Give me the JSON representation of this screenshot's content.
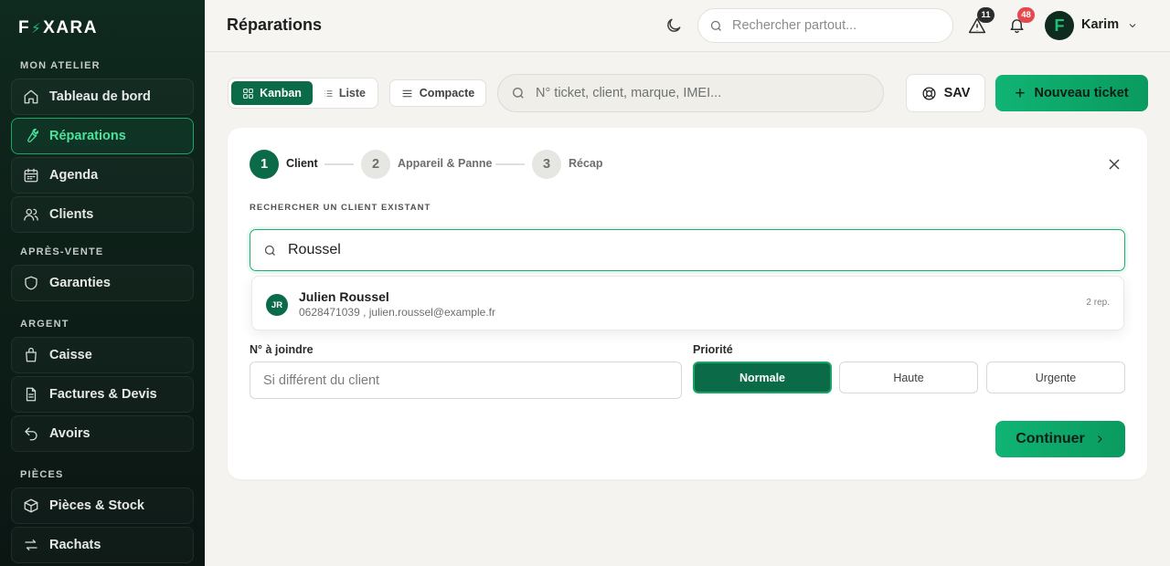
{
  "app": {
    "logo": {
      "left": "F",
      "bolt": "⚡",
      "right": "XARA"
    }
  },
  "sidebar": {
    "sections": [
      {
        "title": "MON ATELIER",
        "items": [
          {
            "label": "Tableau de bord",
            "icon": "home-icon"
          },
          {
            "label": "Réparations",
            "icon": "wrench-icon",
            "active": true
          },
          {
            "label": "Agenda",
            "icon": "calendar-icon"
          },
          {
            "label": "Clients",
            "icon": "users-icon"
          }
        ]
      },
      {
        "title": "APRÈS-VENTE",
        "items": [
          {
            "label": "Garanties",
            "icon": "shield-icon"
          }
        ]
      },
      {
        "title": "ARGENT",
        "items": [
          {
            "label": "Caisse",
            "icon": "cash-register-icon"
          },
          {
            "label": "Factures & Devis",
            "icon": "document-icon"
          },
          {
            "label": "Avoirs",
            "icon": "undo-icon"
          }
        ]
      },
      {
        "title": "PIÈCES",
        "items": [
          {
            "label": "Pièces & Stock",
            "icon": "box-icon"
          },
          {
            "label": "Rachats",
            "icon": "exchange-icon"
          }
        ]
      }
    ]
  },
  "header": {
    "title": "Réparations",
    "search_placeholder": "Rechercher partout...",
    "alerts_count": "11",
    "notifications_count": "48",
    "user": {
      "initial": "F",
      "name": "Karim"
    }
  },
  "toolbar": {
    "views": [
      {
        "label": "Kanban",
        "active": true
      },
      {
        "label": "Liste",
        "active": false
      }
    ],
    "compact_label": "Compacte",
    "search_placeholder": "N° ticket, client, marque, IMEI...",
    "sav_label": "SAV",
    "new_ticket_label": "Nouveau ticket",
    "accent_color": "#0b6b48"
  },
  "wizard": {
    "steps": [
      {
        "number": "1",
        "label": "Client",
        "active": true
      },
      {
        "number": "2",
        "label": "Appareil & Panne",
        "active": false
      },
      {
        "number": "3",
        "label": "Récap",
        "active": false
      }
    ],
    "search_label": "RECHERCHER UN CLIENT EXISTANT",
    "search_value": "Roussel",
    "result": {
      "initials": "JR",
      "name": "Julien Roussel",
      "contact": "0628471039 , julien.roussel@example.fr",
      "repairs": "2 rep."
    },
    "phone_label": "N° à joindre",
    "phone_placeholder": "Si différent du client",
    "priority_label": "Priorité",
    "priorities": [
      {
        "label": "Normale",
        "selected": true
      },
      {
        "label": "Haute",
        "selected": false
      },
      {
        "label": "Urgente",
        "selected": false
      }
    ],
    "continue_label": "Continuer"
  }
}
